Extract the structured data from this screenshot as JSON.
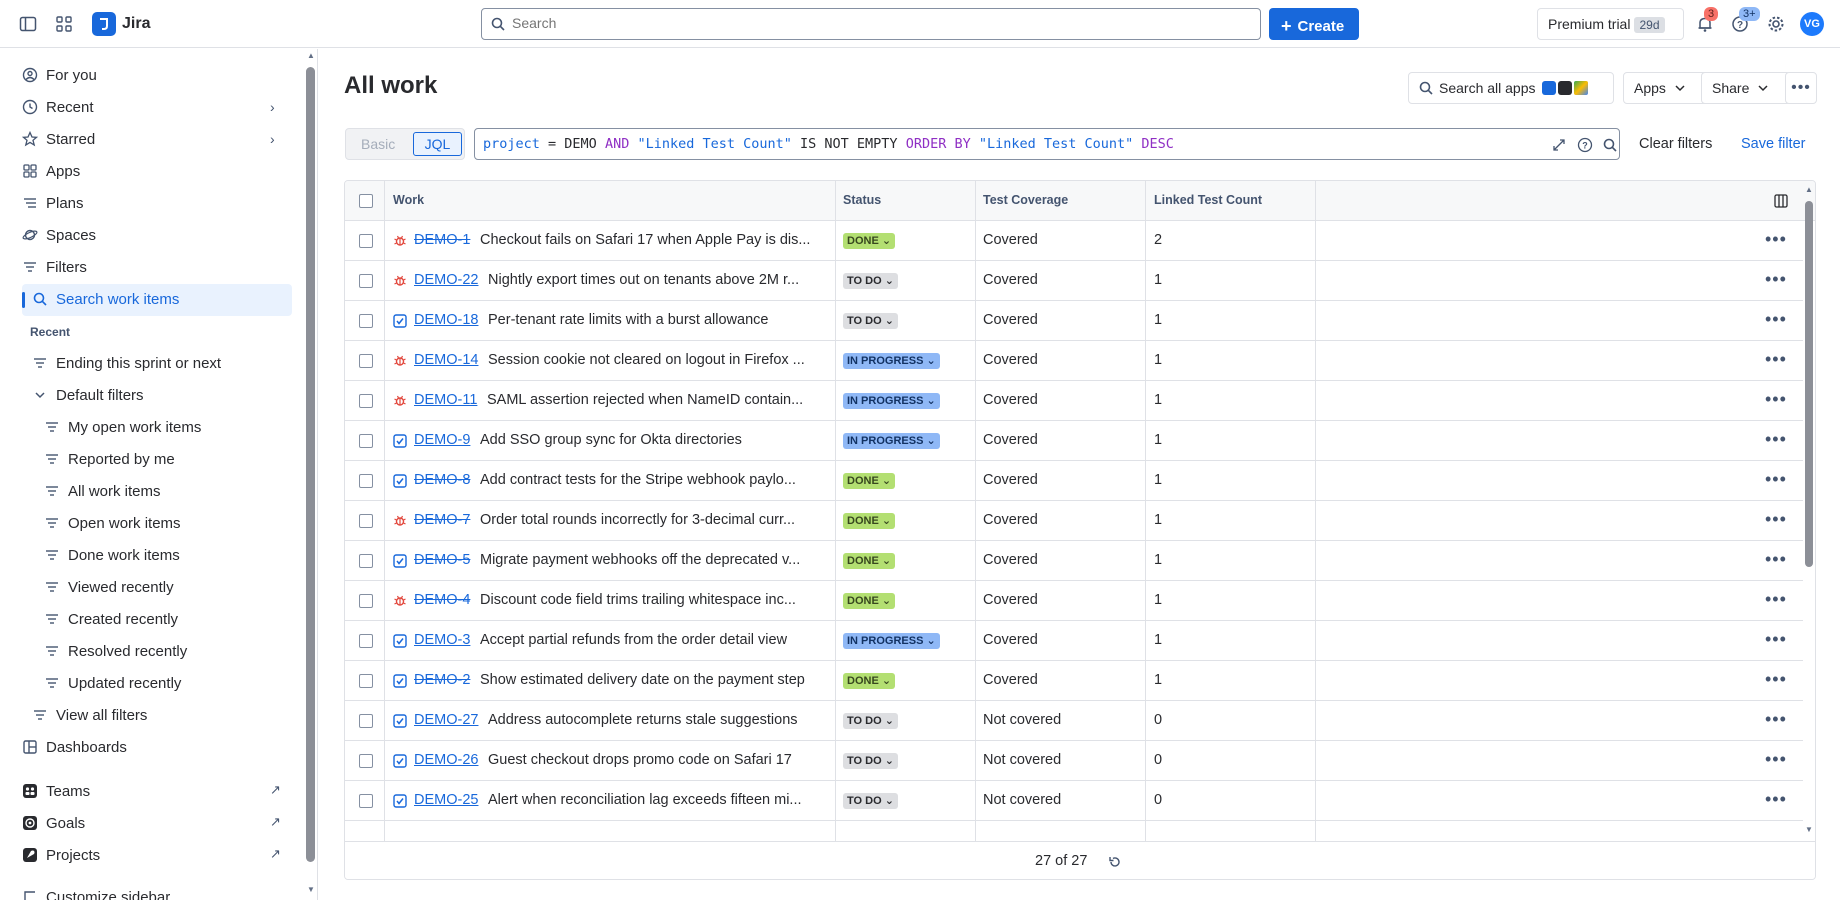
{
  "topbar": {
    "app_name": "Jira",
    "search_placeholder": "Search",
    "create_label": "Create",
    "trial_label": "Premium trial",
    "trial_days": "29d",
    "notifications_count": "3",
    "help_count": "3+",
    "avatar_initials": "VG"
  },
  "sidebar": {
    "for_you": "For you",
    "recent": "Recent",
    "starred": "Starred",
    "apps": "Apps",
    "plans": "Plans",
    "spaces": "Spaces",
    "filters": "Filters",
    "search_work_items": "Search work items",
    "recent_section": "Recent",
    "ending_sprint": "Ending this sprint or next",
    "default_filters": "Default filters",
    "default_items": [
      "My open work items",
      "Reported by me",
      "All work items",
      "Open work items",
      "Done work items",
      "Viewed recently",
      "Created recently",
      "Resolved recently",
      "Updated recently"
    ],
    "view_all_filters": "View all filters",
    "dashboards": "Dashboards",
    "teams": "Teams",
    "goals": "Goals",
    "projects": "Projects",
    "customize": "Customize sidebar"
  },
  "main": {
    "title": "All work",
    "search_apps": "Search all apps",
    "apps_btn": "Apps",
    "share_btn": "Share",
    "toggle_basic": "Basic",
    "toggle_jql": "JQL",
    "jql": {
      "t1": "project",
      "t2": " = ",
      "t3": "DEMO",
      "t4": " AND ",
      "t5": "\"Linked Test Count\"",
      "t6": " IS NOT EMPTY ",
      "t7": "ORDER BY",
      "t8": " \"Linked Test Count\" ",
      "t9": "DESC"
    },
    "clear_filters": "Clear filters",
    "save_filter": "Save filter",
    "colors": {
      "accent": "#1868db",
      "border": "#dfe1e6"
    }
  },
  "table": {
    "headers": {
      "work": "Work",
      "status": "Status",
      "coverage": "Test Coverage",
      "count": "Linked Test Count"
    },
    "rows": [
      {
        "type": "bug",
        "key": "DEMO-1",
        "done": true,
        "summary": "Checkout fails on Safari 17 when Apple Pay is dis...",
        "status": "DONE",
        "coverage": "Covered",
        "count": "2"
      },
      {
        "type": "bug",
        "key": "DEMO-22",
        "done": false,
        "summary": "Nightly export times out on tenants above 2M r...",
        "status": "TO DO",
        "coverage": "Covered",
        "count": "1"
      },
      {
        "type": "task",
        "key": "DEMO-18",
        "done": false,
        "summary": "Per-tenant rate limits with a burst allowance",
        "status": "TO DO",
        "coverage": "Covered",
        "count": "1"
      },
      {
        "type": "bug",
        "key": "DEMO-14",
        "done": false,
        "summary": "Session cookie not cleared on logout in Firefox ...",
        "status": "IN PROGRESS",
        "coverage": "Covered",
        "count": "1"
      },
      {
        "type": "bug",
        "key": "DEMO-11",
        "done": false,
        "summary": "SAML assertion rejected when NameID contain...",
        "status": "IN PROGRESS",
        "coverage": "Covered",
        "count": "1"
      },
      {
        "type": "task",
        "key": "DEMO-9",
        "done": false,
        "summary": "Add SSO group sync for Okta directories",
        "status": "IN PROGRESS",
        "coverage": "Covered",
        "count": "1"
      },
      {
        "type": "task",
        "key": "DEMO-8",
        "done": true,
        "summary": "Add contract tests for the Stripe webhook paylo...",
        "status": "DONE",
        "coverage": "Covered",
        "count": "1"
      },
      {
        "type": "bug",
        "key": "DEMO-7",
        "done": true,
        "summary": "Order total rounds incorrectly for 3-decimal curr...",
        "status": "DONE",
        "coverage": "Covered",
        "count": "1"
      },
      {
        "type": "task",
        "key": "DEMO-5",
        "done": true,
        "summary": "Migrate payment webhooks off the deprecated v...",
        "status": "DONE",
        "coverage": "Covered",
        "count": "1"
      },
      {
        "type": "bug",
        "key": "DEMO-4",
        "done": true,
        "summary": "Discount code field trims trailing whitespace inc...",
        "status": "DONE",
        "coverage": "Covered",
        "count": "1"
      },
      {
        "type": "task",
        "key": "DEMO-3",
        "done": false,
        "summary": "Accept partial refunds from the order detail view",
        "status": "IN PROGRESS",
        "coverage": "Covered",
        "count": "1"
      },
      {
        "type": "task",
        "key": "DEMO-2",
        "done": true,
        "summary": "Show estimated delivery date on the payment step",
        "status": "DONE",
        "coverage": "Covered",
        "count": "1"
      },
      {
        "type": "task",
        "key": "DEMO-27",
        "done": false,
        "summary": "Address autocomplete returns stale suggestions",
        "status": "TO DO",
        "coverage": "Not covered",
        "count": "0"
      },
      {
        "type": "task",
        "key": "DEMO-26",
        "done": false,
        "summary": "Guest checkout drops promo code on Safari 17",
        "status": "TO DO",
        "coverage": "Not covered",
        "count": "0"
      },
      {
        "type": "task",
        "key": "DEMO-25",
        "done": false,
        "summary": "Alert when reconciliation lag exceeds fifteen mi...",
        "status": "TO DO",
        "coverage": "Not covered",
        "count": "0"
      }
    ],
    "footer_count": "27 of 27"
  }
}
